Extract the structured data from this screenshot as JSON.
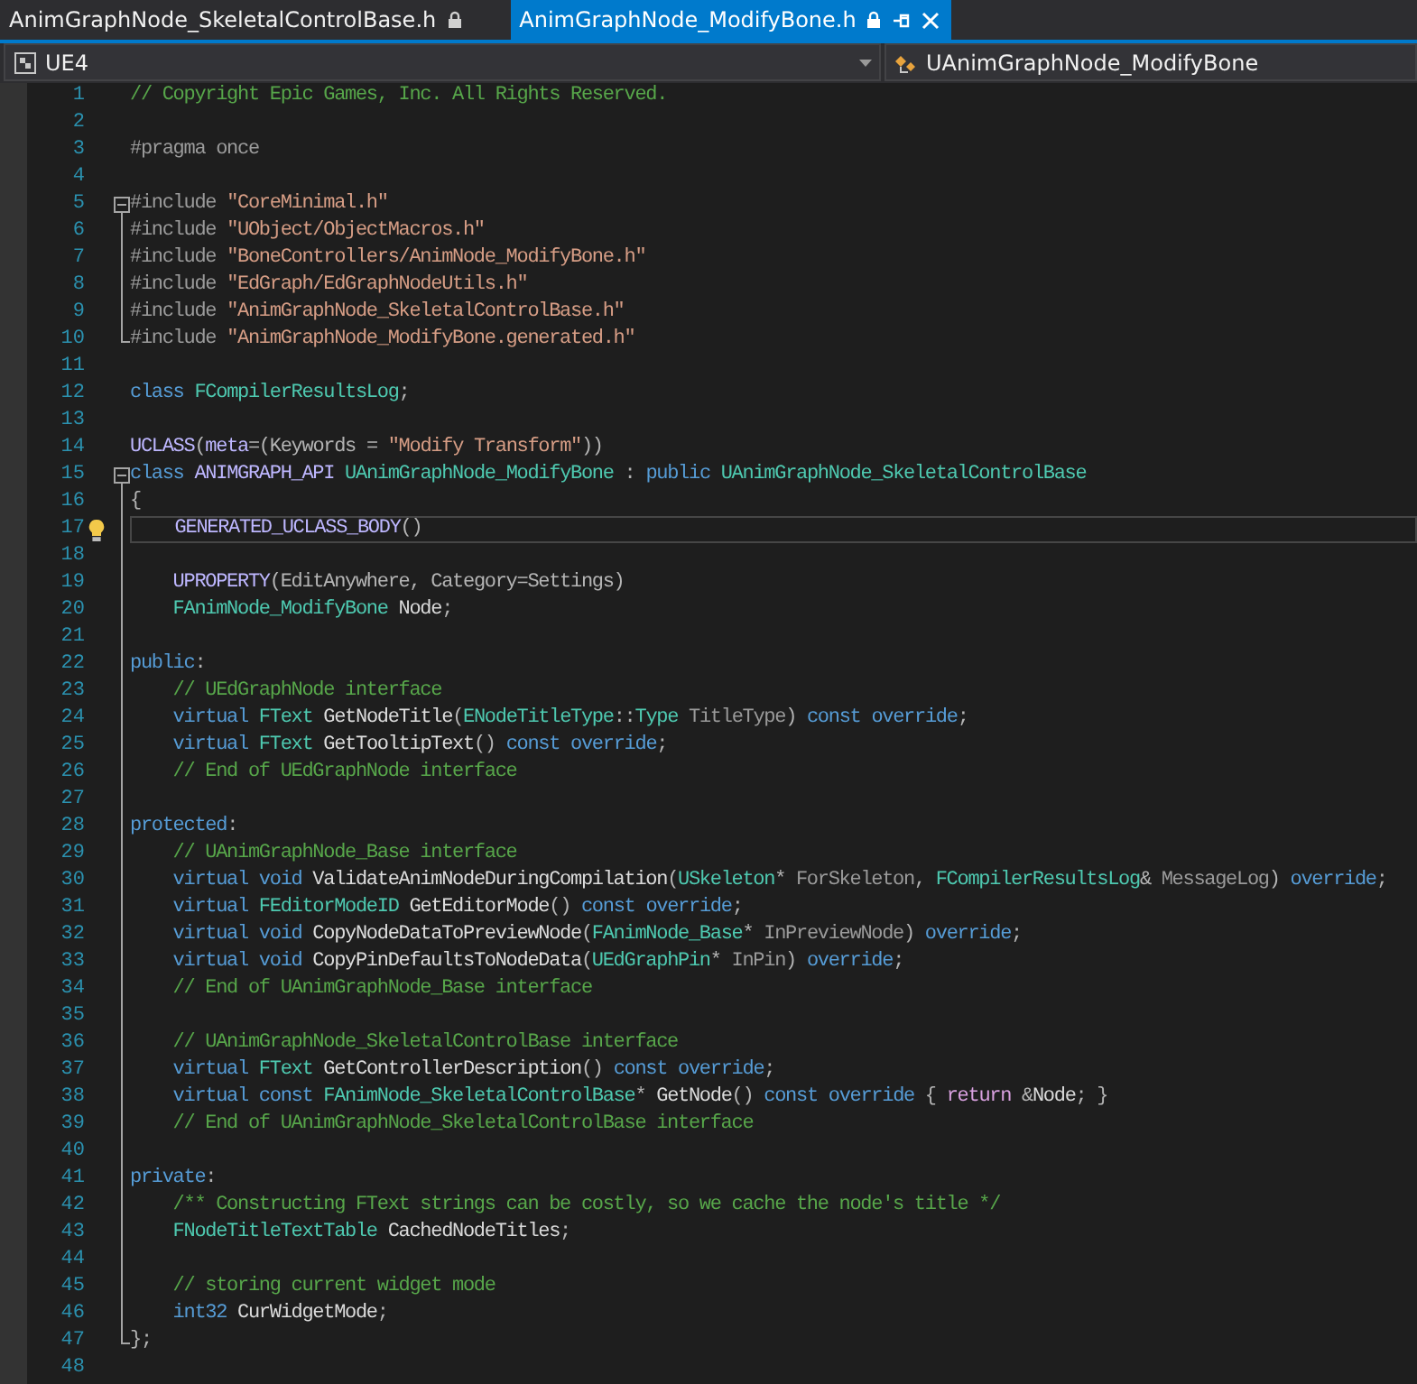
{
  "tabs": [
    {
      "label": "AnimGraphNode_SkeletalControlBase.h",
      "selected": false,
      "read_only": true
    },
    {
      "label": "AnimGraphNode_ModifyBone.h",
      "selected": true,
      "read_only": true
    }
  ],
  "navigation": [
    {
      "kind": "project",
      "text": "UE4"
    },
    {
      "kind": "class",
      "text": "UAnimGraphNode_ModifyBone"
    }
  ],
  "lines": [
    {
      "number": "1",
      "kind": "plain",
      "current": false,
      "bulb": false,
      "tokens": [
        {
          "kind": "comment",
          "text": "// Copyright Epic Games, Inc. All Rights Reserved."
        }
      ]
    },
    {
      "number": "2",
      "kind": "plain",
      "current": false,
      "bulb": false
    },
    {
      "number": "3",
      "kind": "plain",
      "current": false,
      "bulb": false,
      "tokens": [
        {
          "kind": "preproc",
          "text": "#pragma once"
        }
      ]
    },
    {
      "number": "4",
      "kind": "plain",
      "current": false,
      "bulb": false
    },
    {
      "number": "5",
      "kind": "fold-start",
      "current": false,
      "bulb": false,
      "tokens": [
        {
          "kind": "preproc",
          "text": "#include "
        },
        {
          "kind": "string",
          "text": "\"CoreMinimal.h\""
        }
      ]
    },
    {
      "number": "6",
      "kind": "fold-inside",
      "current": false,
      "bulb": false,
      "tokens": [
        {
          "kind": "preproc",
          "text": "#include "
        },
        {
          "kind": "string",
          "text": "\"UObject/ObjectMacros.h\""
        }
      ]
    },
    {
      "number": "7",
      "kind": "fold-inside",
      "current": false,
      "bulb": false,
      "tokens": [
        {
          "kind": "preproc",
          "text": "#include "
        },
        {
          "kind": "string",
          "text": "\"BoneControllers/AnimNode_ModifyBone.h\""
        }
      ]
    },
    {
      "number": "8",
      "kind": "fold-inside",
      "current": false,
      "bulb": false,
      "tokens": [
        {
          "kind": "preproc",
          "text": "#include "
        },
        {
          "kind": "string",
          "text": "\"EdGraph/EdGraphNodeUtils.h\""
        }
      ]
    },
    {
      "number": "9",
      "kind": "fold-inside",
      "current": false,
      "bulb": false,
      "tokens": [
        {
          "kind": "preproc",
          "text": "#include "
        },
        {
          "kind": "string",
          "text": "\"AnimGraphNode_SkeletalControlBase.h\""
        }
      ]
    },
    {
      "number": "10",
      "kind": "fold-end",
      "current": false,
      "bulb": false,
      "tokens": [
        {
          "kind": "preproc",
          "text": "#include "
        },
        {
          "kind": "string",
          "text": "\"AnimGraphNode_ModifyBone.generated.h\""
        }
      ]
    },
    {
      "number": "11",
      "kind": "plain",
      "current": false,
      "bulb": false
    },
    {
      "number": "12",
      "kind": "plain",
      "current": false,
      "bulb": false,
      "tokens": [
        {
          "kind": "keyword",
          "text": "class "
        },
        {
          "kind": "type",
          "text": "FCompilerResultsLog"
        },
        {
          "kind": "plain",
          "text": ";"
        }
      ]
    },
    {
      "number": "13",
      "kind": "plain",
      "current": false,
      "bulb": false
    },
    {
      "number": "14",
      "kind": "plain",
      "current": false,
      "bulb": false,
      "tokens": [
        {
          "kind": "macro",
          "text": "UCLASS"
        },
        {
          "kind": "plain",
          "text": "("
        },
        {
          "kind": "macro",
          "text": "meta"
        },
        {
          "kind": "plain",
          "text": "=(Keywords = "
        },
        {
          "kind": "string",
          "text": "\"Modify Transform\""
        },
        {
          "kind": "plain",
          "text": "))"
        }
      ]
    },
    {
      "number": "15",
      "kind": "fold-start",
      "current": false,
      "bulb": false,
      "tokens": [
        {
          "kind": "keyword",
          "text": "class "
        },
        {
          "kind": "macro",
          "text": "ANIMGRAPH_API "
        },
        {
          "kind": "type",
          "text": "UAnimGraphNode_ModifyBone"
        },
        {
          "kind": "plain",
          "text": " : "
        },
        {
          "kind": "keyword",
          "text": "public "
        },
        {
          "kind": "type",
          "text": "UAnimGraphNode_SkeletalControlBase"
        }
      ]
    },
    {
      "number": "16",
      "kind": "fold-inside",
      "current": false,
      "bulb": false,
      "tokens": [
        {
          "kind": "plain",
          "text": "{"
        }
      ]
    },
    {
      "number": "17",
      "kind": "fold-inside",
      "current": true,
      "bulb": true,
      "tokens": [
        {
          "kind": "macro",
          "text": "    GENERATED_UCLASS_BODY"
        },
        {
          "kind": "plain",
          "text": "()"
        }
      ]
    },
    {
      "number": "18",
      "kind": "fold-inside",
      "current": false,
      "bulb": false
    },
    {
      "number": "19",
      "kind": "fold-inside",
      "current": false,
      "bulb": false,
      "tokens": [
        {
          "kind": "macro",
          "text": "    UPROPERTY"
        },
        {
          "kind": "plain",
          "text": "(EditAnywhere, Category=Settings)"
        }
      ]
    },
    {
      "number": "20",
      "kind": "fold-inside",
      "current": false,
      "bulb": false,
      "tokens": [
        {
          "kind": "type",
          "text": "    FAnimNode_ModifyBone "
        },
        {
          "kind": "member",
          "text": "Node"
        },
        {
          "kind": "plain",
          "text": ";"
        }
      ]
    },
    {
      "number": "21",
      "kind": "fold-inside",
      "current": false,
      "bulb": false
    },
    {
      "number": "22",
      "kind": "fold-inside",
      "current": false,
      "bulb": false,
      "tokens": [
        {
          "kind": "keyword",
          "text": "public"
        },
        {
          "kind": "plain",
          "text": ":"
        }
      ]
    },
    {
      "number": "23",
      "kind": "fold-inside",
      "current": false,
      "bulb": false,
      "tokens": [
        {
          "kind": "comment",
          "text": "    // UEdGraphNode interface"
        }
      ]
    },
    {
      "number": "24",
      "kind": "fold-inside",
      "current": false,
      "bulb": false,
      "tokens": [
        {
          "kind": "keyword",
          "text": "    virtual "
        },
        {
          "kind": "type",
          "text": "FText "
        },
        {
          "kind": "func",
          "text": "GetNodeTitle"
        },
        {
          "kind": "plain",
          "text": "("
        },
        {
          "kind": "type",
          "text": "ENodeTitleType"
        },
        {
          "kind": "plain",
          "text": "::"
        },
        {
          "kind": "type",
          "text": "Type "
        },
        {
          "kind": "param",
          "text": "TitleType"
        },
        {
          "kind": "plain",
          "text": ") "
        },
        {
          "kind": "keyword",
          "text": "const override"
        },
        {
          "kind": "plain",
          "text": ";"
        }
      ]
    },
    {
      "number": "25",
      "kind": "fold-inside",
      "current": false,
      "bulb": false,
      "tokens": [
        {
          "kind": "keyword",
          "text": "    virtual "
        },
        {
          "kind": "type",
          "text": "FText "
        },
        {
          "kind": "func",
          "text": "GetTooltipText"
        },
        {
          "kind": "plain",
          "text": "() "
        },
        {
          "kind": "keyword",
          "text": "const override"
        },
        {
          "kind": "plain",
          "text": ";"
        }
      ]
    },
    {
      "number": "26",
      "kind": "fold-inside",
      "current": false,
      "bulb": false,
      "tokens": [
        {
          "kind": "comment",
          "text": "    // End of UEdGraphNode interface"
        }
      ]
    },
    {
      "number": "27",
      "kind": "fold-inside",
      "current": false,
      "bulb": false
    },
    {
      "number": "28",
      "kind": "fold-inside",
      "current": false,
      "bulb": false,
      "tokens": [
        {
          "kind": "keyword",
          "text": "protected"
        },
        {
          "kind": "plain",
          "text": ":"
        }
      ]
    },
    {
      "number": "29",
      "kind": "fold-inside",
      "current": false,
      "bulb": false,
      "tokens": [
        {
          "kind": "comment",
          "text": "    // UAnimGraphNode_Base interface"
        }
      ]
    },
    {
      "number": "30",
      "kind": "fold-inside",
      "current": false,
      "bulb": false,
      "tokens": [
        {
          "kind": "keyword",
          "text": "    virtual void "
        },
        {
          "kind": "func",
          "text": "ValidateAnimNodeDuringCompilation"
        },
        {
          "kind": "plain",
          "text": "("
        },
        {
          "kind": "type",
          "text": "USkeleton"
        },
        {
          "kind": "plain",
          "text": "* "
        },
        {
          "kind": "param",
          "text": "ForSkeleton"
        },
        {
          "kind": "plain",
          "text": ", "
        },
        {
          "kind": "type",
          "text": "FCompilerResultsLog"
        },
        {
          "kind": "plain",
          "text": "& "
        },
        {
          "kind": "param",
          "text": "MessageLog"
        },
        {
          "kind": "plain",
          "text": ") "
        },
        {
          "kind": "keyword",
          "text": "override"
        },
        {
          "kind": "plain",
          "text": ";"
        }
      ]
    },
    {
      "number": "31",
      "kind": "fold-inside",
      "current": false,
      "bulb": false,
      "tokens": [
        {
          "kind": "keyword",
          "text": "    virtual "
        },
        {
          "kind": "type",
          "text": "FEditorModeID "
        },
        {
          "kind": "func",
          "text": "GetEditorMode"
        },
        {
          "kind": "plain",
          "text": "() "
        },
        {
          "kind": "keyword",
          "text": "const override"
        },
        {
          "kind": "plain",
          "text": ";"
        }
      ]
    },
    {
      "number": "32",
      "kind": "fold-inside",
      "current": false,
      "bulb": false,
      "tokens": [
        {
          "kind": "keyword",
          "text": "    virtual void "
        },
        {
          "kind": "func",
          "text": "CopyNodeDataToPreviewNode"
        },
        {
          "kind": "plain",
          "text": "("
        },
        {
          "kind": "type",
          "text": "FAnimNode_Base"
        },
        {
          "kind": "plain",
          "text": "* "
        },
        {
          "kind": "param",
          "text": "InPreviewNode"
        },
        {
          "kind": "plain",
          "text": ") "
        },
        {
          "kind": "keyword",
          "text": "override"
        },
        {
          "kind": "plain",
          "text": ";"
        }
      ]
    },
    {
      "number": "33",
      "kind": "fold-inside",
      "current": false,
      "bulb": false,
      "tokens": [
        {
          "kind": "keyword",
          "text": "    virtual void "
        },
        {
          "kind": "func",
          "text": "CopyPinDefaultsToNodeData"
        },
        {
          "kind": "plain",
          "text": "("
        },
        {
          "kind": "type",
          "text": "UEdGraphPin"
        },
        {
          "kind": "plain",
          "text": "* "
        },
        {
          "kind": "param",
          "text": "InPin"
        },
        {
          "kind": "plain",
          "text": ") "
        },
        {
          "kind": "keyword",
          "text": "override"
        },
        {
          "kind": "plain",
          "text": ";"
        }
      ]
    },
    {
      "number": "34",
      "kind": "fold-inside",
      "current": false,
      "bulb": false,
      "tokens": [
        {
          "kind": "comment",
          "text": "    // End of UAnimGraphNode_Base interface"
        }
      ]
    },
    {
      "number": "35",
      "kind": "fold-inside",
      "current": false,
      "bulb": false
    },
    {
      "number": "36",
      "kind": "fold-inside",
      "current": false,
      "bulb": false,
      "tokens": [
        {
          "kind": "comment",
          "text": "    // UAnimGraphNode_SkeletalControlBase interface"
        }
      ]
    },
    {
      "number": "37",
      "kind": "fold-inside",
      "current": false,
      "bulb": false,
      "tokens": [
        {
          "kind": "keyword",
          "text": "    virtual "
        },
        {
          "kind": "type",
          "text": "FText "
        },
        {
          "kind": "func",
          "text": "GetControllerDescription"
        },
        {
          "kind": "plain",
          "text": "() "
        },
        {
          "kind": "keyword",
          "text": "const override"
        },
        {
          "kind": "plain",
          "text": ";"
        }
      ]
    },
    {
      "number": "38",
      "kind": "fold-inside",
      "current": false,
      "bulb": false,
      "tokens": [
        {
          "kind": "keyword",
          "text": "    virtual const "
        },
        {
          "kind": "type",
          "text": "FAnimNode_SkeletalControlBase"
        },
        {
          "kind": "plain",
          "text": "* "
        },
        {
          "kind": "func",
          "text": "GetNode"
        },
        {
          "kind": "plain",
          "text": "() "
        },
        {
          "kind": "keyword",
          "text": "const override"
        },
        {
          "kind": "plain",
          "text": " { "
        },
        {
          "kind": "control",
          "text": "return"
        },
        {
          "kind": "plain",
          "text": " &"
        },
        {
          "kind": "member",
          "text": "Node"
        },
        {
          "kind": "plain",
          "text": "; }"
        }
      ]
    },
    {
      "number": "39",
      "kind": "fold-inside",
      "current": false,
      "bulb": false,
      "tokens": [
        {
          "kind": "comment",
          "text": "    // End of UAnimGraphNode_SkeletalControlBase interface"
        }
      ]
    },
    {
      "number": "40",
      "kind": "fold-inside",
      "current": false,
      "bulb": false
    },
    {
      "number": "41",
      "kind": "fold-inside",
      "current": false,
      "bulb": false,
      "tokens": [
        {
          "kind": "keyword",
          "text": "private"
        },
        {
          "kind": "plain",
          "text": ":"
        }
      ]
    },
    {
      "number": "42",
      "kind": "fold-inside",
      "current": false,
      "bulb": false,
      "tokens": [
        {
          "kind": "comment",
          "text": "    /** Constructing FText strings can be costly, so we cache the node's title */"
        }
      ]
    },
    {
      "number": "43",
      "kind": "fold-inside",
      "current": false,
      "bulb": false,
      "tokens": [
        {
          "kind": "type",
          "text": "    FNodeTitleTextTable "
        },
        {
          "kind": "member",
          "text": "CachedNodeTitles"
        },
        {
          "kind": "plain",
          "text": ";"
        }
      ]
    },
    {
      "number": "44",
      "kind": "fold-inside",
      "current": false,
      "bulb": false
    },
    {
      "number": "45",
      "kind": "fold-inside",
      "current": false,
      "bulb": false,
      "tokens": [
        {
          "kind": "comment",
          "text": "    // storing current widget mode"
        }
      ]
    },
    {
      "number": "46",
      "kind": "fold-inside",
      "current": false,
      "bulb": false,
      "tokens": [
        {
          "kind": "keyword",
          "text": "    int32 "
        },
        {
          "kind": "member",
          "text": "CurWidgetMode"
        },
        {
          "kind": "plain",
          "text": ";"
        }
      ]
    },
    {
      "number": "47",
      "kind": "fold-end",
      "current": false,
      "bulb": false,
      "tokens": [
        {
          "kind": "plain",
          "text": "};"
        }
      ]
    },
    {
      "number": "48",
      "kind": "plain",
      "current": false,
      "bulb": false
    }
  ]
}
